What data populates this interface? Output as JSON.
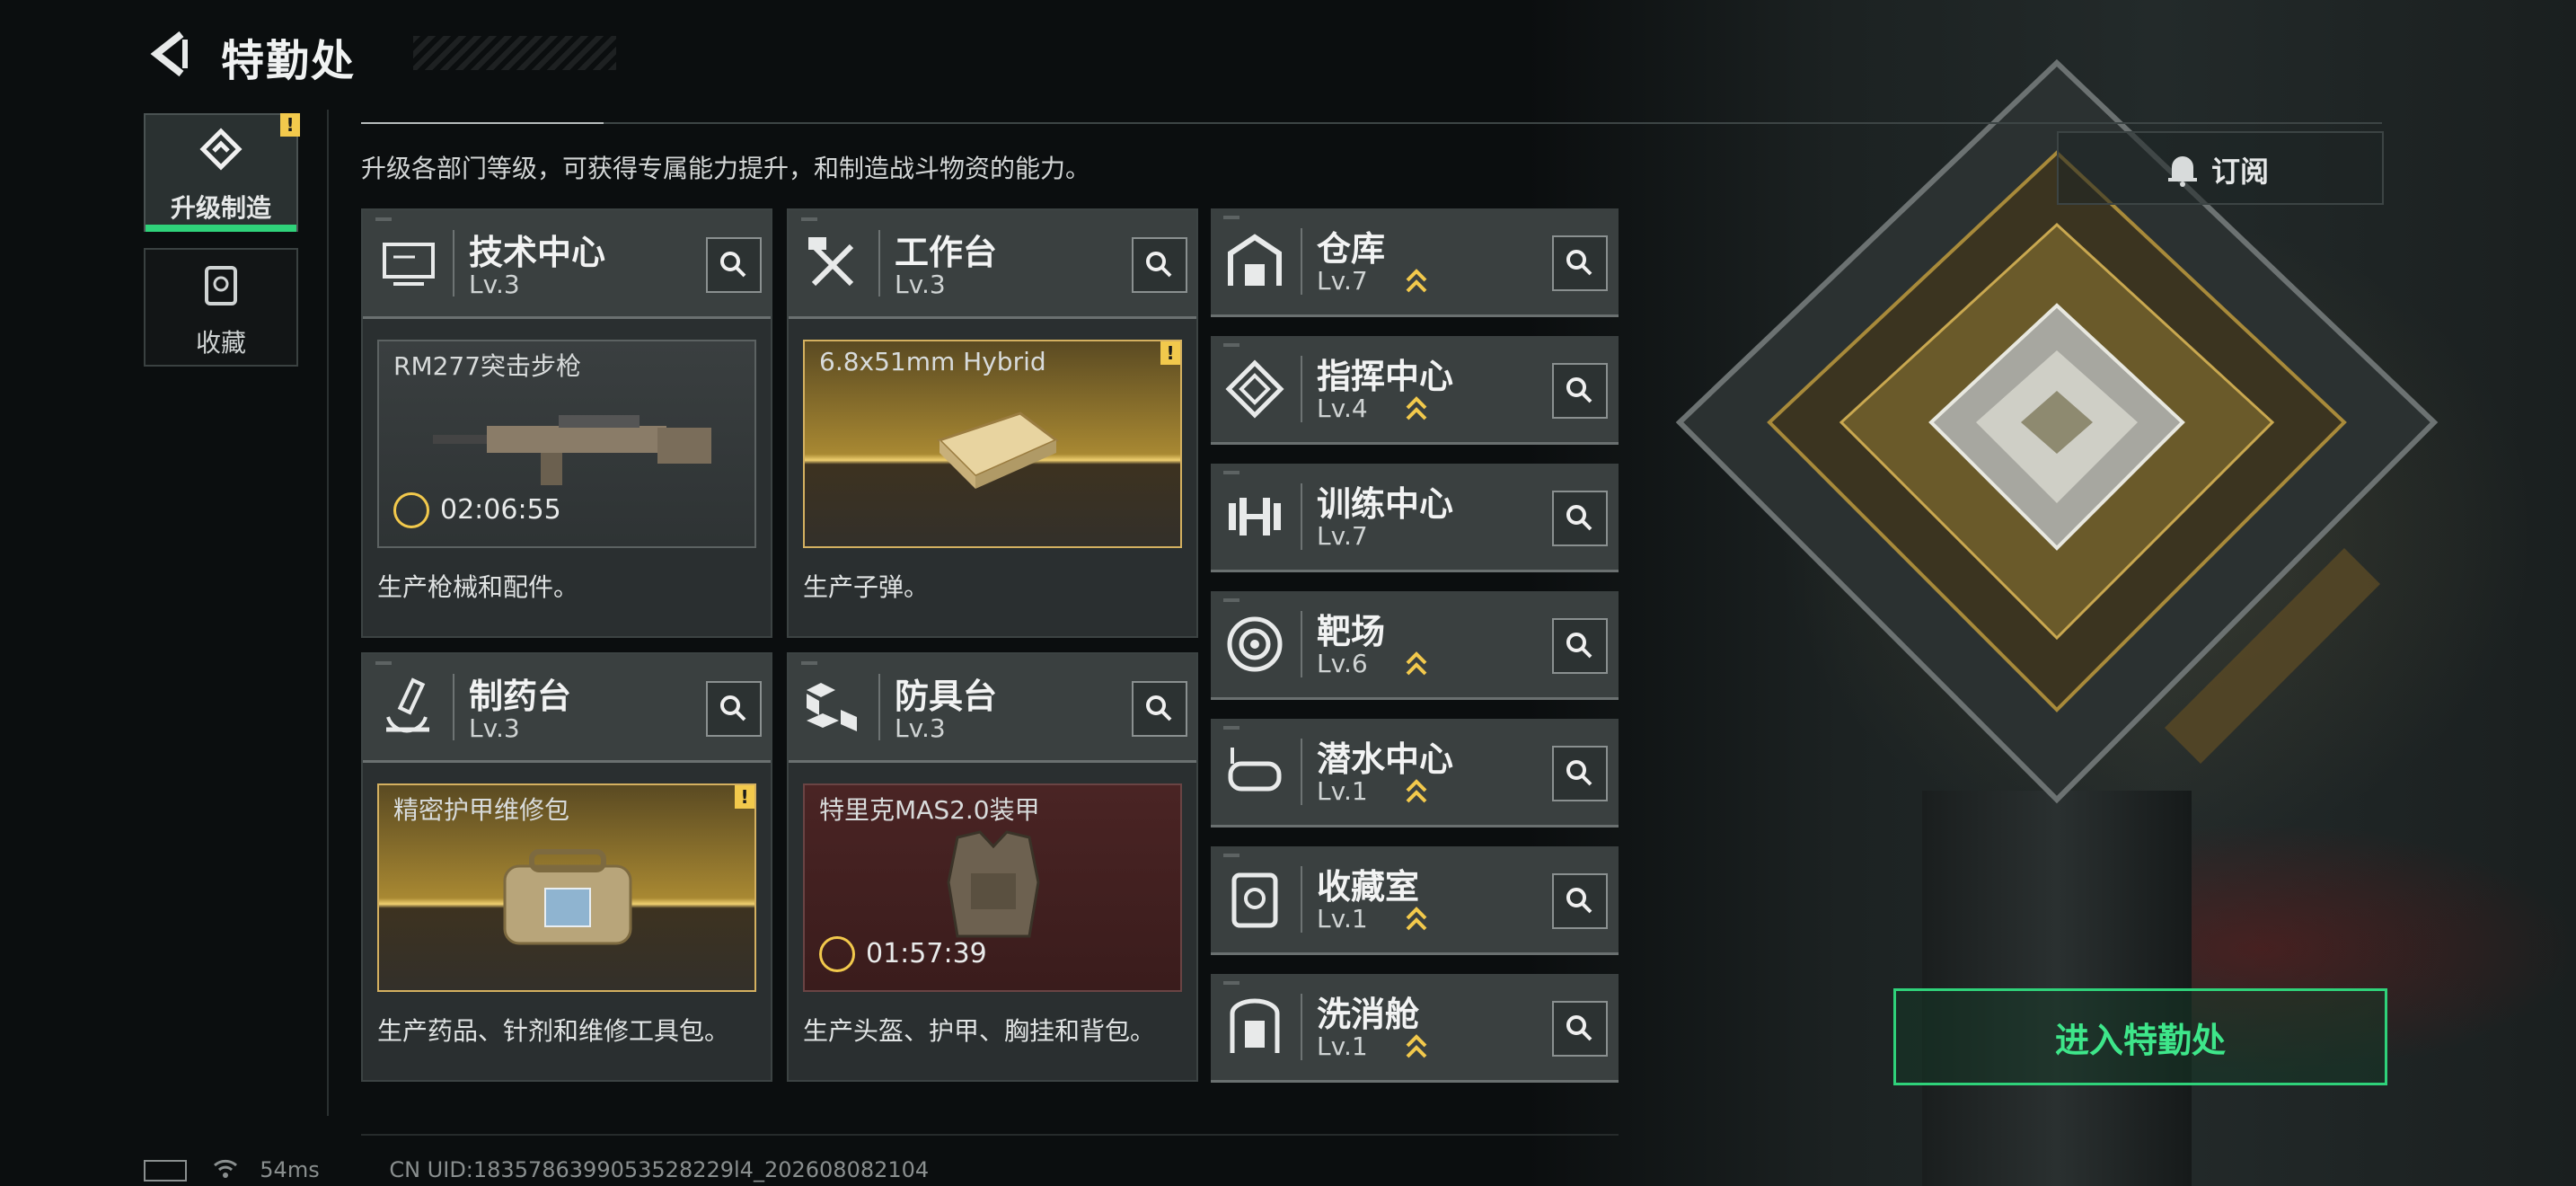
{
  "header": {
    "title": "特勤处"
  },
  "sidebar": {
    "tabs": [
      {
        "label": "升级制造",
        "badge": "!"
      },
      {
        "label": "收藏"
      }
    ]
  },
  "subtitle": "升级各部门等级，可获得专属能力提升，和制造战斗物资的能力。",
  "subscribe": {
    "label": "订阅"
  },
  "cards": [
    {
      "name": "技术中心",
      "level": "Lv.3",
      "product": "RM277突击步枪",
      "timer": "02:06:55",
      "desc": "生产枪械和配件。",
      "icon": "monitor-icon"
    },
    {
      "name": "工作台",
      "level": "Lv.3",
      "product": "6.8x51mm Hybrid",
      "badge": "!",
      "desc": "生产子弹。",
      "icon": "tools-icon"
    },
    {
      "name": "制药台",
      "level": "Lv.3",
      "product": "精密护甲维修包",
      "badge": "!",
      "desc": "生产药品、针剂和维修工具包。",
      "icon": "microscope-icon"
    },
    {
      "name": "防具台",
      "level": "Lv.3",
      "product": "特里克MAS2.0装甲",
      "timer": "01:57:39",
      "desc": "生产头盔、护甲、胸挂和背包。",
      "icon": "boxes-icon"
    }
  ],
  "facilities": [
    {
      "name": "仓库",
      "level": "Lv.7",
      "upgradable": true,
      "icon": "warehouse-icon"
    },
    {
      "name": "指挥中心",
      "level": "Lv.4",
      "upgradable": true,
      "icon": "command-icon"
    },
    {
      "name": "训练中心",
      "level": "Lv.7",
      "upgradable": false,
      "icon": "dumbbell-icon"
    },
    {
      "name": "靶场",
      "level": "Lv.6",
      "upgradable": true,
      "icon": "target-icon"
    },
    {
      "name": "潜水中心",
      "level": "Lv.1",
      "upgradable": true,
      "icon": "dive-mask-icon"
    },
    {
      "name": "收藏室",
      "level": "Lv.1",
      "upgradable": true,
      "icon": "collection-icon"
    },
    {
      "name": "洗消舱",
      "level": "Lv.1",
      "upgradable": true,
      "icon": "decon-icon"
    }
  ],
  "enter_button": {
    "label": "进入特勤处"
  },
  "footer": {
    "ping": "54ms",
    "uid": "CN UID:1835786399053528229l4_202608082104"
  },
  "colors": {
    "accent": "#2fd27a",
    "warning": "#f2c94c"
  }
}
